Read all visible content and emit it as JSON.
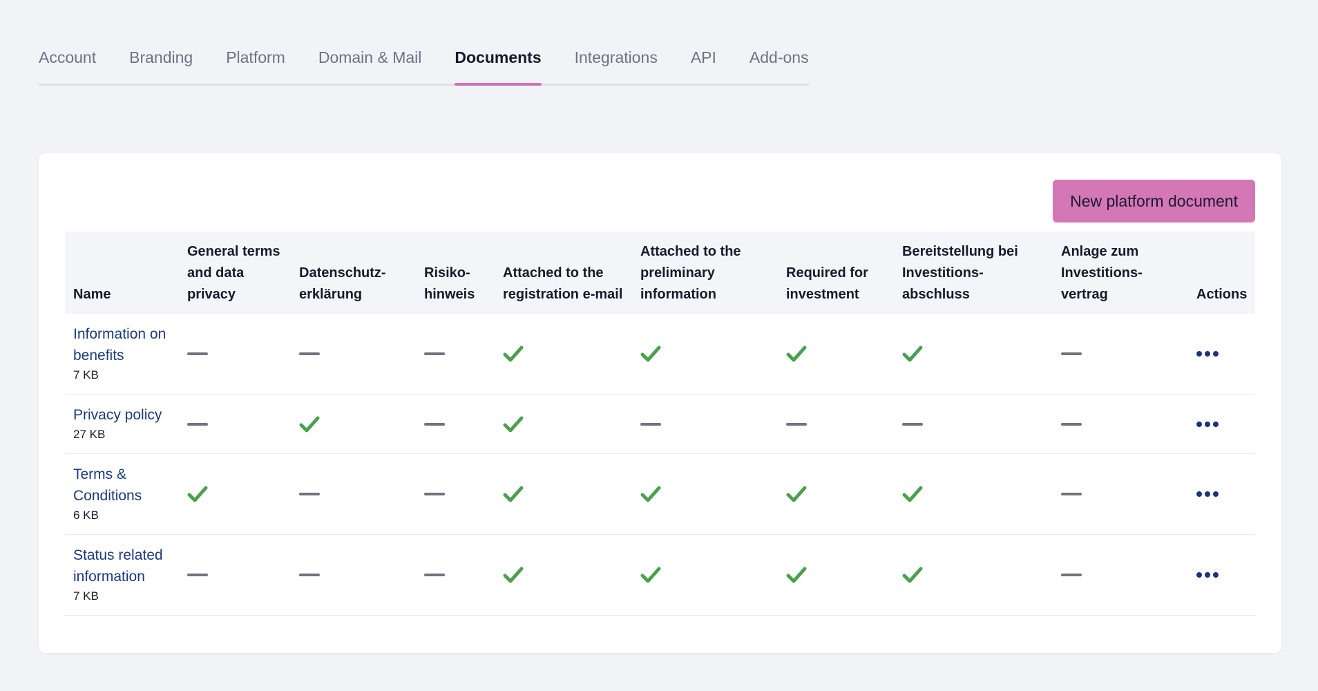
{
  "tabs": [
    {
      "label": "Account",
      "active": false
    },
    {
      "label": "Branding",
      "active": false
    },
    {
      "label": "Platform",
      "active": false
    },
    {
      "label": "Domain & Mail",
      "active": false
    },
    {
      "label": "Documents",
      "active": true
    },
    {
      "label": "Integrations",
      "active": false
    },
    {
      "label": "API",
      "active": false
    },
    {
      "label": "Add-ons",
      "active": false
    }
  ],
  "toolbar": {
    "new_document_label": "New platform document"
  },
  "table": {
    "headers": {
      "name": "Name",
      "general_terms": "General terms and data privacy",
      "datenschutz": "Datenschutz-erklärung",
      "risiko": "Risiko-hinweis",
      "attached_registration": "Attached to the registration e-mail",
      "attached_preliminary": "Attached to the preliminary information",
      "required_investment": "Required for investment",
      "bereitstellung": "Bereitstellung bei Investitions-abschluss",
      "anlage": "Anlage zum Investitions-vertrag",
      "actions": "Actions"
    },
    "rows": [
      {
        "name": "Information on benefits",
        "size": "7 KB",
        "flags": [
          false,
          false,
          false,
          true,
          true,
          true,
          true,
          false
        ]
      },
      {
        "name": "Privacy policy",
        "size": "27 KB",
        "flags": [
          false,
          true,
          false,
          true,
          false,
          false,
          false,
          false
        ]
      },
      {
        "name": "Terms & Conditions",
        "size": "6 KB",
        "flags": [
          true,
          false,
          false,
          true,
          true,
          true,
          true,
          false
        ]
      },
      {
        "name": "Status related information",
        "size": "7 KB",
        "flags": [
          false,
          false,
          false,
          true,
          true,
          true,
          true,
          false
        ]
      }
    ]
  },
  "icons": {
    "checked": "check-icon",
    "unchecked": "dash-icon",
    "actions": "more-horizontal-icon"
  },
  "colors": {
    "accent": "#d377b7",
    "check": "#4aa04e",
    "link": "#1b3a7a"
  }
}
